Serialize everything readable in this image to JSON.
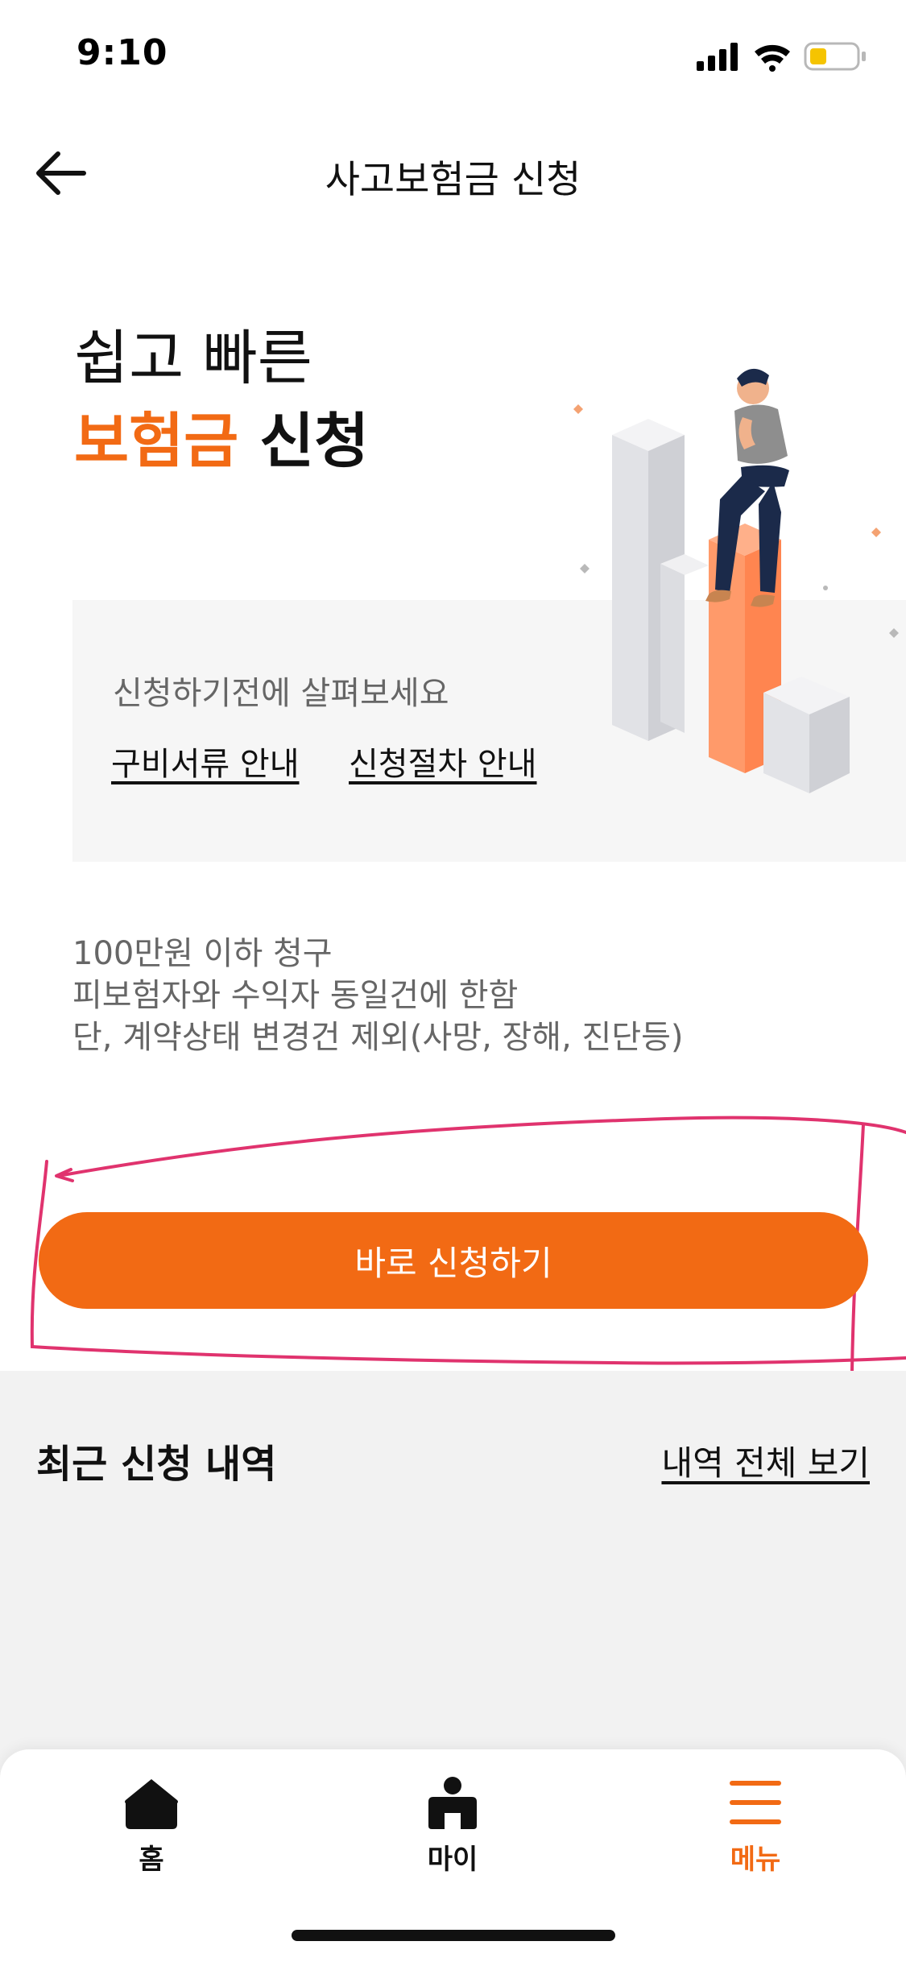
{
  "status_bar": {
    "time": "9:10"
  },
  "header": {
    "title": "사고보험금 신청"
  },
  "hero": {
    "line1": "쉽고 빠른",
    "line2_accent": "보험금",
    "line2_rest": " 신청"
  },
  "info_card": {
    "hint": "신청하기전에 살펴보세요",
    "links": [
      "구비서류 안내",
      "신청절차 안내"
    ]
  },
  "notes": [
    "100만원 이하 청구",
    "피보험자와 수익자 동일건에 한함",
    "단, 계약상태 변경건 제외(사망, 장해, 진단등)"
  ],
  "apply_button": {
    "label": "바로 신청하기"
  },
  "recent": {
    "title": "최근 신청 내역",
    "view_all": "내역 전체 보기"
  },
  "bottom_nav": {
    "items": [
      {
        "label": "홈",
        "icon": "home-icon"
      },
      {
        "label": "마이",
        "icon": "person-icon"
      },
      {
        "label": "메뉴",
        "icon": "hamburger-menu-icon",
        "active": true
      }
    ]
  },
  "colors": {
    "accent": "#f26a14",
    "annotation": "#e0336e",
    "section_bg": "#f2f2f2"
  }
}
